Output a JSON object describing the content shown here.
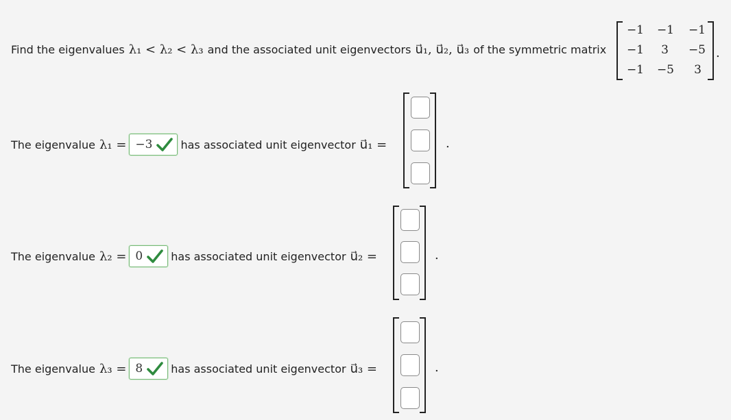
{
  "question": {
    "prefix": "Find the eigenvalues",
    "eigen_order": "λ₁ < λ₂ < λ₃",
    "middle": "and the associated unit eigenvectors",
    "vectors": "u⃗₁, u⃗₂, u⃗₃",
    "suffix": "of the symmetric matrix",
    "matrix": [
      [
        "−1",
        "−1",
        "−1"
      ],
      [
        "−1",
        "3",
        "−5"
      ],
      [
        "−1",
        "−5",
        "3"
      ]
    ],
    "end": "."
  },
  "rows": [
    {
      "label": "The eigenvalue",
      "lambda": "λ₁ =",
      "answer": "−3",
      "mid_text": "has associated unit eigenvector",
      "vector": "u⃗₁ =",
      "end": "."
    },
    {
      "label": "The eigenvalue",
      "lambda": "λ₂ =",
      "answer": "0",
      "mid_text": "has associated unit eigenvector",
      "vector": "u⃗₂ =",
      "end": "."
    },
    {
      "label": "The eigenvalue",
      "lambda": "λ₃ =",
      "answer": "8",
      "mid_text": "has associated unit eigenvector",
      "vector": "u⃗₃ =",
      "end": "."
    }
  ],
  "colors": {
    "check": "#2e8b3e",
    "answer_border": "#78b878",
    "background": "#f4f4f4"
  },
  "icons": {
    "correct": "checkmark-icon"
  }
}
